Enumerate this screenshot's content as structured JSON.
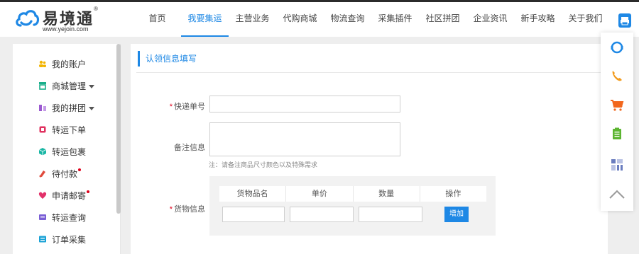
{
  "brand": {
    "name": "易境通",
    "reg": "®",
    "url": "www.yejoin.com"
  },
  "nav": [
    {
      "label": "首页",
      "active": false
    },
    {
      "label": "我要集运",
      "active": true
    },
    {
      "label": "主营业务",
      "active": false
    },
    {
      "label": "代购商城",
      "active": false
    },
    {
      "label": "物流查询",
      "active": false
    },
    {
      "label": "采集插件",
      "active": false
    },
    {
      "label": "社区拼团",
      "active": false
    },
    {
      "label": "企业资讯",
      "active": false
    },
    {
      "label": "新手攻略",
      "active": false
    },
    {
      "label": "关于我们",
      "active": false
    }
  ],
  "sidebar": {
    "items": [
      {
        "label": "我的账户",
        "icon": "user-icon",
        "color": "#f2b400",
        "caret": false,
        "dot": false
      },
      {
        "label": "商城管理",
        "icon": "shop-icon",
        "color": "#1aaf8b",
        "caret": true,
        "dot": false
      },
      {
        "label": "我的拼团",
        "icon": "group-icon",
        "color": "#9b59d0",
        "caret": true,
        "dot": false
      },
      {
        "label": "转运下单",
        "icon": "order-icon",
        "color": "#e0315f",
        "caret": false,
        "dot": false
      },
      {
        "label": "转运包裹",
        "icon": "package-icon",
        "color": "#18b6a4",
        "caret": false,
        "dot": false
      },
      {
        "label": "待付款",
        "icon": "pay-icon",
        "color": "#e04a3c",
        "caret": false,
        "dot": true
      },
      {
        "label": "申请邮寄",
        "icon": "mail-icon",
        "color": "#e2316a",
        "caret": false,
        "dot": true
      },
      {
        "label": "转运查询",
        "icon": "query-icon",
        "color": "#7b5fd6",
        "caret": false,
        "dot": false
      },
      {
        "label": "订单采集",
        "icon": "collect-icon",
        "color": "#1aa2d6",
        "caret": false,
        "dot": false
      }
    ]
  },
  "main": {
    "title": "认领信息填写",
    "fields": {
      "tracking_label": "快递单号",
      "tracking_value": "",
      "remark_label": "备注信息",
      "remark_value": "",
      "note": "注：请备注商品尺寸颜色以及特殊需求",
      "goods_label": "货物信息"
    },
    "goods_table": {
      "headers": [
        "货物品名",
        "单价",
        "数量",
        "操作"
      ],
      "add_label": "增加"
    }
  },
  "float_bar": {
    "items": [
      {
        "icon": "customer-service-icon",
        "color": "#1e88e5"
      },
      {
        "icon": "phone-icon",
        "color": "#f29b1d"
      },
      {
        "icon": "cart-icon",
        "color": "#f2671d"
      },
      {
        "icon": "clipboard-icon",
        "color": "#5cb531"
      },
      {
        "icon": "qrcode-icon",
        "color": "#6a7dbf"
      },
      {
        "icon": "back-to-top-icon",
        "color": "#999999"
      }
    ]
  },
  "colors": {
    "accent": "#1e88e5",
    "required": "#e0001b"
  }
}
